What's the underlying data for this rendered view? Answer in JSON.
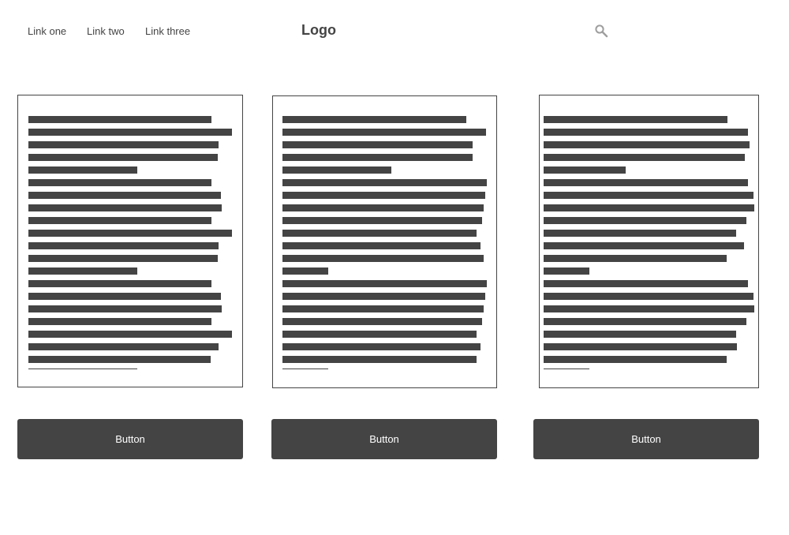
{
  "header": {
    "nav_links": [
      "Link one",
      "Link two",
      "Link three"
    ],
    "logo": "Logo",
    "search_icon": "search-icon"
  },
  "cards": [
    {
      "buttonLabel": "Button"
    },
    {
      "buttonLabel": "Button"
    },
    {
      "buttonLabel": "Button"
    }
  ],
  "colors": {
    "ink": "#444444",
    "button_text": "#ffffff",
    "icon": "#9e9e9e",
    "background": "#ffffff"
  }
}
